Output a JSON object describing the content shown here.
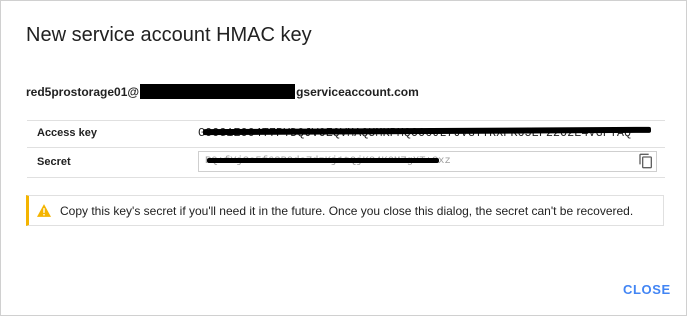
{
  "dialog": {
    "title": "New service account HMAC key",
    "account": {
      "prefix": "red5prostorage01@",
      "suffix": "gserviceaccount.com"
    },
    "access_key": {
      "label": "Access key",
      "value": "GOOG1EO04T7PYDQJVOEQVMAQUMKPMQOO6JL7JVGYTRXPK65EF22O2E4VGFTAQ"
    },
    "secret": {
      "label": "Secret",
      "value": "RQ+fYjSa5f63B9dcZdzKj1tQjK84KOMZgXT+Gxz",
      "copy_icon": "copy-icon"
    },
    "warning": {
      "icon": "warning-icon",
      "text": "Copy this key's secret if you'll need it in the future. Once you close this dialog, the secret can't be recovered.",
      "accent_color": "#f4b400"
    },
    "close_label": "CLOSE",
    "accent_color": "#4285f4"
  }
}
